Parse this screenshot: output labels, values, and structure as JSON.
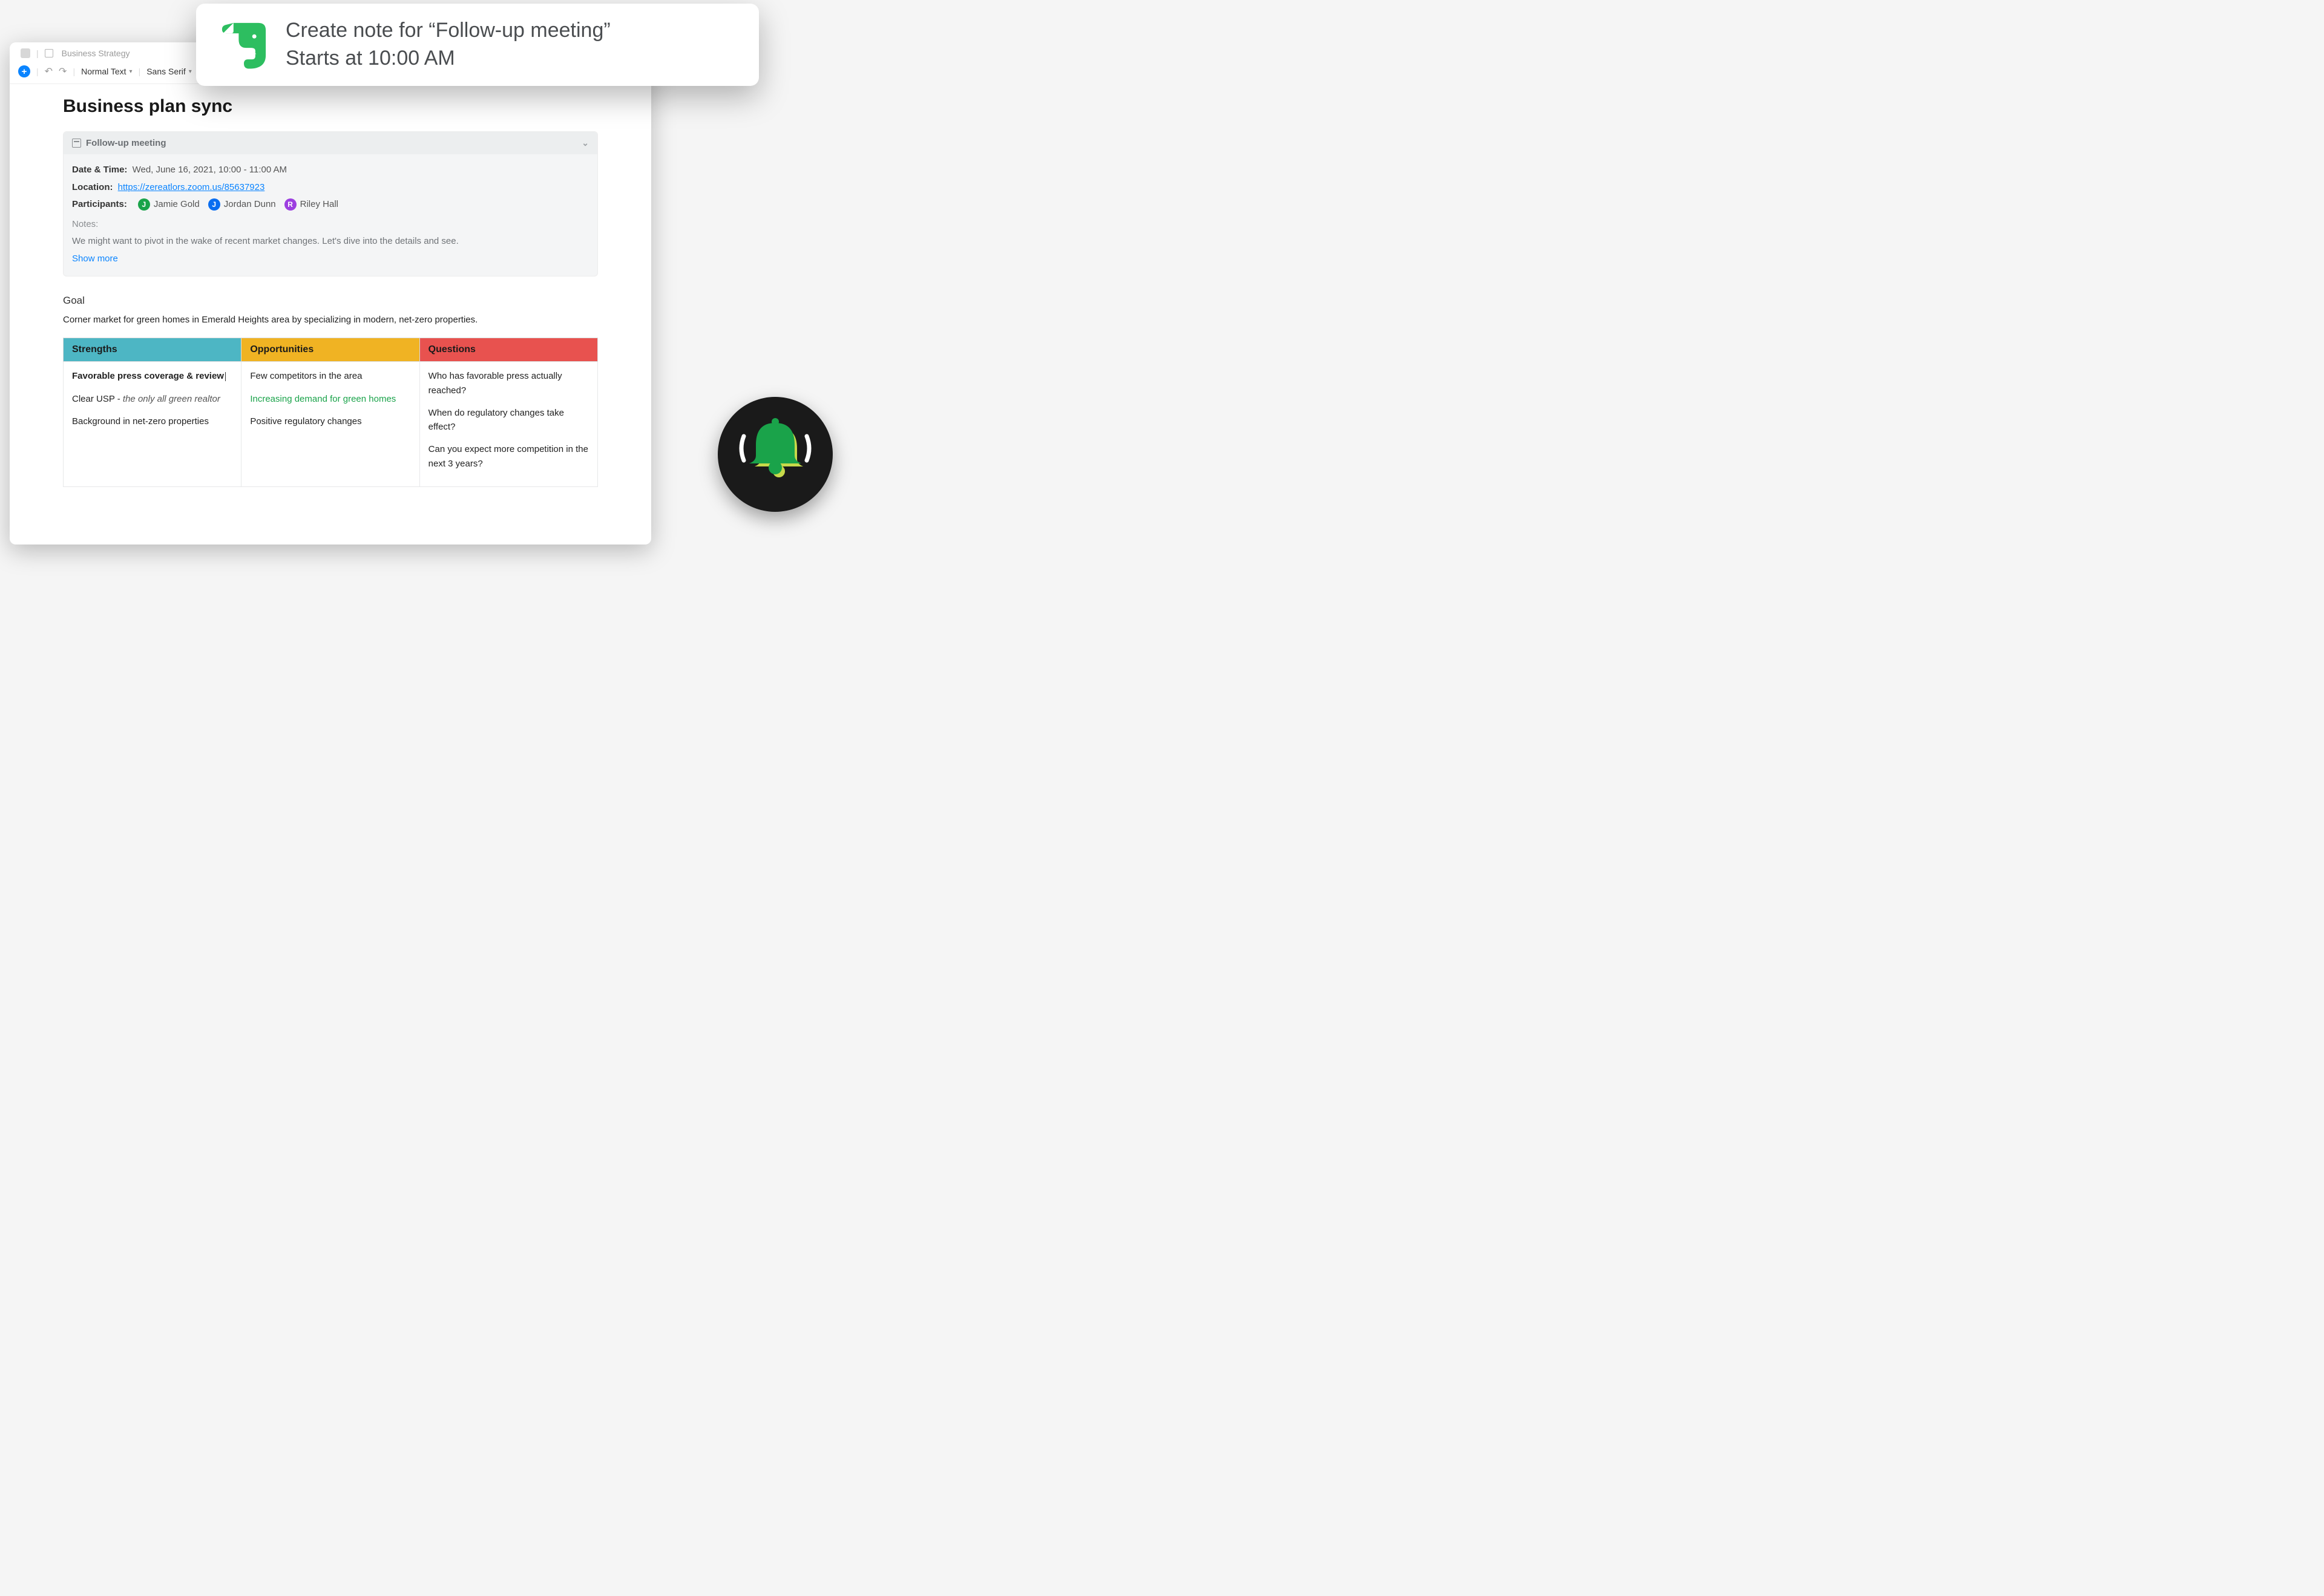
{
  "breadcrumb": {
    "notebook": "Business Strategy"
  },
  "toolbar": {
    "style_label": "Normal Text",
    "font_label": "Sans Serif"
  },
  "page": {
    "title": "Business plan sync"
  },
  "meeting": {
    "title": "Follow-up meeting",
    "date_label": "Date & Time:",
    "date_value": "Wed, June 16, 2021, 10:00 - 11:00 AM",
    "location_label": "Location:",
    "location_url": "https://zereatlors.zoom.us/85637923",
    "participants_label": "Participants:",
    "participants": [
      {
        "initial": "J",
        "name": "Jamie Gold",
        "color": "#1aa34a"
      },
      {
        "initial": "J",
        "name": "Jordan Dunn",
        "color": "#0a6ef0"
      },
      {
        "initial": "R",
        "name": "Riley Hall",
        "color": "#9c3fe0"
      }
    ],
    "notes_label": "Notes:",
    "notes_text": "We might want to pivot in the wake of recent market changes. Let's dive into the details and see.",
    "show_more": "Show more"
  },
  "goal": {
    "heading": "Goal",
    "text": "Corner market for green homes in Emerald Heights area by specializing in modern, net-zero properties."
  },
  "swot": {
    "headers": {
      "strengths": "Strengths",
      "opportunities": "Opportunities",
      "questions": "Questions"
    },
    "strengths": {
      "line1": "Favorable press coverage & review",
      "usp_prefix": "Clear USP - ",
      "usp_ital": "the only all green realtor",
      "line3": "Background in net-zero properties"
    },
    "opportunities": {
      "o1": "Few competitors in the area",
      "o2": "Increasing demand for green homes",
      "o3": "Positive regulatory changes"
    },
    "questions": {
      "q1": "Who has favorable press actually reached?",
      "q2": "When do regulatory changes take effect?",
      "q3": "Can you expect more competition in the next 3 years?"
    }
  },
  "notification": {
    "line1": "Create note for “Follow-up meeting”",
    "line2": "Starts at 10:00 AM"
  },
  "colors": {
    "teal": "#4db6c4",
    "amber": "#f0b323",
    "red": "#e8524f",
    "green": "#1aa34a",
    "link": "#0a84ff",
    "evernote": "#2dbe60"
  }
}
